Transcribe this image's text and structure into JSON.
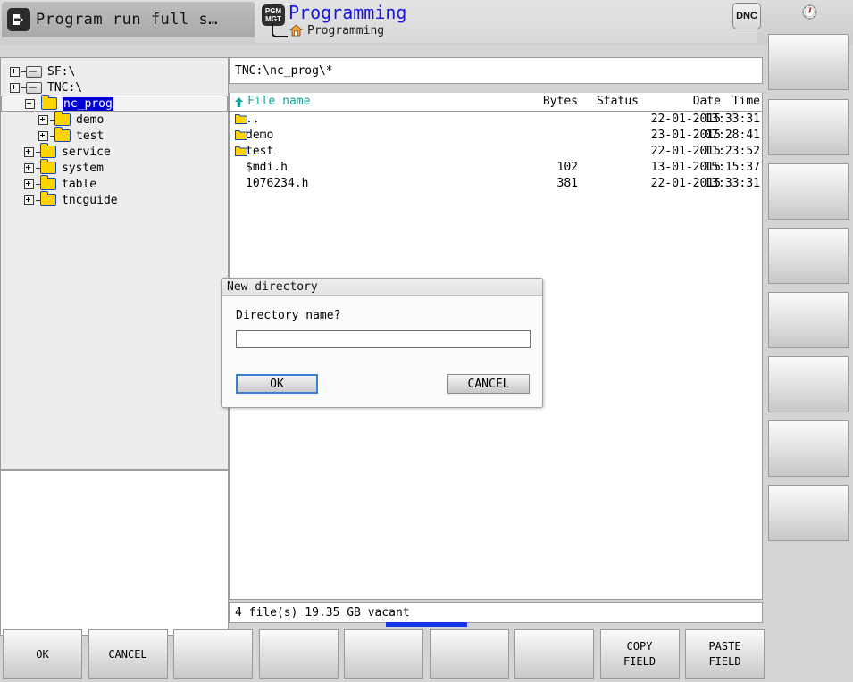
{
  "topbar": {
    "mode_tab_label": "Program run full s…",
    "mode_icon": "arrow-into-box-icon",
    "pgm_icon_line1": "PGM",
    "pgm_icon_line2": "MGT",
    "app_title": "Programming",
    "app_subtitle": "Programming",
    "dnc_label": "DNC",
    "gauge_icon": "gauge-icon",
    "accent_blue": "#1a16e0"
  },
  "tree": {
    "items": [
      {
        "label": "SF:\\",
        "type": "drive",
        "indent": 0,
        "expander": "plus",
        "selected": false
      },
      {
        "label": "TNC:\\",
        "type": "drive",
        "indent": 0,
        "expander": "plus",
        "selected": false
      },
      {
        "label": "nc_prog",
        "type": "folder-open",
        "indent": 1,
        "expander": "minus",
        "selected": true
      },
      {
        "label": "demo",
        "type": "folder",
        "indent": 2,
        "expander": "plus",
        "selected": false
      },
      {
        "label": "test",
        "type": "folder",
        "indent": 2,
        "expander": "plus",
        "selected": false
      },
      {
        "label": "service",
        "type": "folder",
        "indent": 1,
        "expander": "plus",
        "selected": false
      },
      {
        "label": "system",
        "type": "folder",
        "indent": 1,
        "expander": "plus",
        "selected": false
      },
      {
        "label": "table",
        "type": "folder",
        "indent": 1,
        "expander": "plus",
        "selected": false
      },
      {
        "label": "tncguide",
        "type": "folder",
        "indent": 1,
        "expander": "plus",
        "selected": false
      }
    ]
  },
  "file_panel": {
    "path": "TNC:\\nc_prog\\*",
    "sort_arrow_icon": "sort-ascending-icon",
    "columns": [
      "File name",
      "Bytes",
      "Status",
      "Date",
      "Time"
    ],
    "rows": [
      {
        "icon": "folder-icon",
        "name": "..",
        "bytes": "",
        "status": "",
        "date": "22-01-2015",
        "time": "13:33:31"
      },
      {
        "icon": "folder-icon",
        "name": "demo",
        "bytes": "",
        "status": "",
        "date": "23-01-2015",
        "time": "07:28:41"
      },
      {
        "icon": "folder-icon",
        "name": "test",
        "bytes": "",
        "status": "",
        "date": "22-01-2015",
        "time": "11:23:52"
      },
      {
        "icon": "",
        "name": "$mdi.h",
        "bytes": "102",
        "status": "",
        "date": "13-01-2015",
        "time": "15:15:37"
      },
      {
        "icon": "",
        "name": "1076234.h",
        "bytes": "381",
        "status": "",
        "date": "22-01-2015",
        "time": "13:33:31"
      }
    ],
    "status_line": "4   file(s)  19.35 GB vacant",
    "header_color": "#11a396"
  },
  "dialog": {
    "title": "New directory",
    "prompt": "Directory name?",
    "input_value": "",
    "ok_label": "OK",
    "cancel_label": "CANCEL",
    "focus_color": "#3b7fd4"
  },
  "softkeys": {
    "bottom": [
      {
        "line1": "OK",
        "line2": ""
      },
      {
        "line1": "CANCEL",
        "line2": ""
      },
      {
        "line1": "",
        "line2": ""
      },
      {
        "line1": "",
        "line2": ""
      },
      {
        "line1": "",
        "line2": ""
      },
      {
        "line1": "",
        "line2": ""
      },
      {
        "line1": "",
        "line2": ""
      },
      {
        "line1": "COPY",
        "line2": "FIELD"
      },
      {
        "line1": "PASTE",
        "line2": "FIELD"
      }
    ],
    "vertical": [
      {
        "label": ""
      },
      {
        "label": ""
      },
      {
        "label": ""
      },
      {
        "label": ""
      },
      {
        "label": ""
      },
      {
        "label": ""
      },
      {
        "label": ""
      },
      {
        "label": ""
      }
    ],
    "page_indicator_color": "#1536e6"
  }
}
